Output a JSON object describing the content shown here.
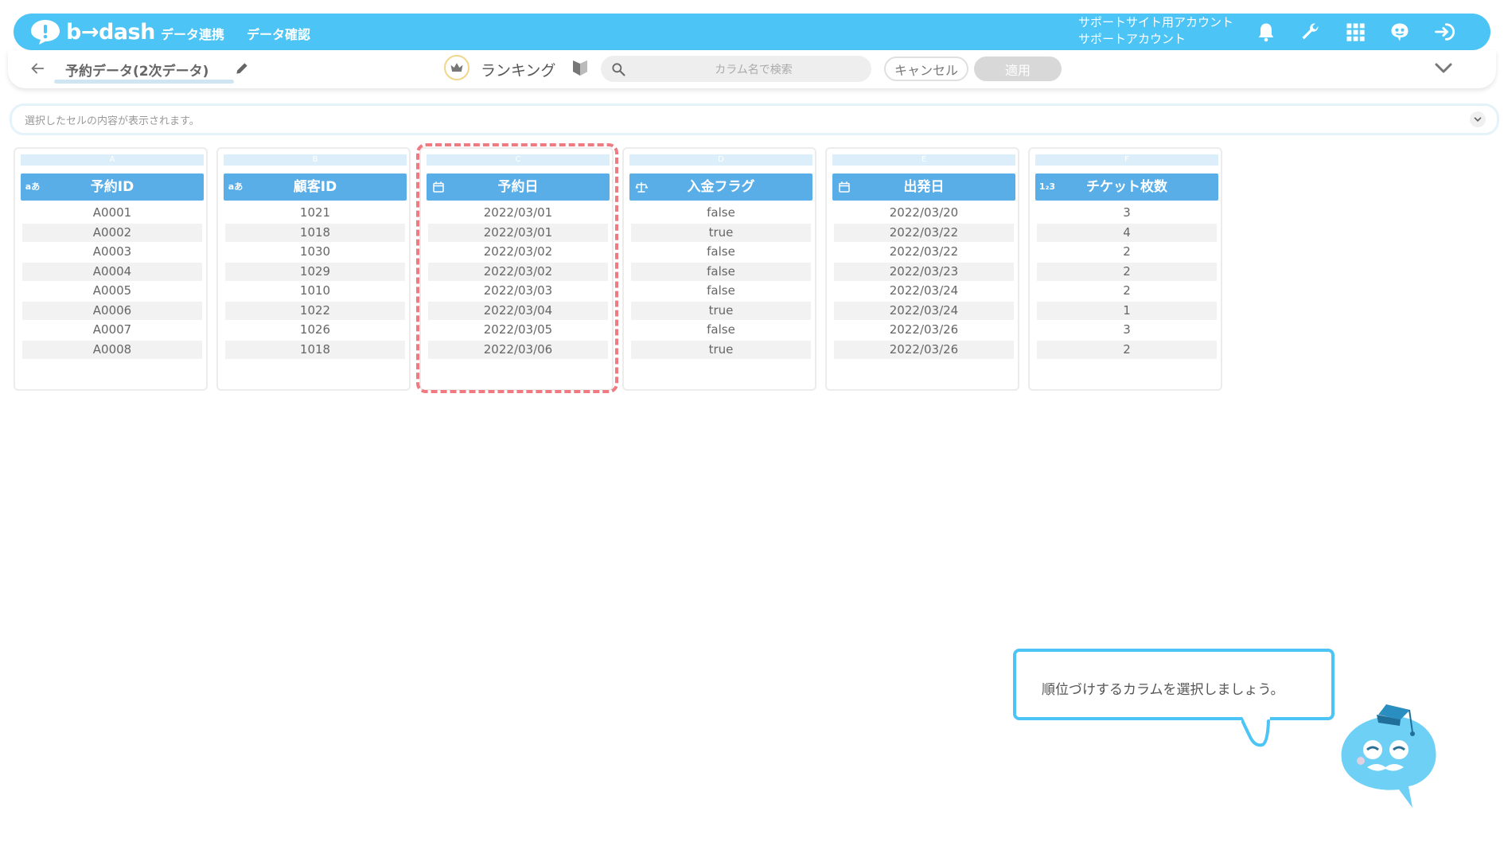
{
  "header": {
    "logo_text": "b→dash",
    "nav": [
      "データ連携",
      "データ確認"
    ],
    "account_line1": "サポートサイト用アカウント",
    "account_line2": "サポートアカウント",
    "icons": [
      "bell-icon",
      "wrench-icon",
      "apps-grid-icon",
      "support-mascot-icon",
      "logout-icon"
    ],
    "brand_color": "#4cc4f5"
  },
  "toolbar": {
    "dataset_name": "予約データ(2次データ)",
    "mode_label": "ランキング",
    "search_placeholder": "カラム名で検索",
    "cancel_label": "キャンセル",
    "apply_label": "適用"
  },
  "cell_bar": {
    "placeholder": "選択したセルの内容が表示されます。"
  },
  "columns": [
    {
      "letter": "A",
      "type_icon": "aあ",
      "title": "予約ID",
      "values": [
        "A0001",
        "A0002",
        "A0003",
        "A0004",
        "A0005",
        "A0006",
        "A0007",
        "A0008"
      ]
    },
    {
      "letter": "B",
      "type_icon": "aあ",
      "title": "顧客ID",
      "values": [
        "1021",
        "1018",
        "1030",
        "1029",
        "1010",
        "1022",
        "1026",
        "1018"
      ]
    },
    {
      "letter": "C",
      "type_icon": "calendar",
      "title": "予約日",
      "values": [
        "2022/03/01",
        "2022/03/01",
        "2022/03/02",
        "2022/03/02",
        "2022/03/03",
        "2022/03/04",
        "2022/03/05",
        "2022/03/06"
      ]
    },
    {
      "letter": "D",
      "type_icon": "scale",
      "title": "入金フラグ",
      "values": [
        "false",
        "true",
        "false",
        "false",
        "false",
        "true",
        "false",
        "true"
      ]
    },
    {
      "letter": "E",
      "type_icon": "calendar",
      "title": "出発日",
      "values": [
        "2022/03/20",
        "2022/03/22",
        "2022/03/22",
        "2022/03/23",
        "2022/03/24",
        "2022/03/24",
        "2022/03/26",
        "2022/03/26"
      ]
    },
    {
      "letter": "F",
      "type_icon": "1₂3",
      "title": "チケット枚数",
      "values": [
        "3",
        "4",
        "2",
        "2",
        "2",
        "1",
        "3",
        "2"
      ]
    }
  ],
  "highlight_color": "#f07a82",
  "tooltip": {
    "text": "順位づけするカラムを選択しましょう。"
  }
}
